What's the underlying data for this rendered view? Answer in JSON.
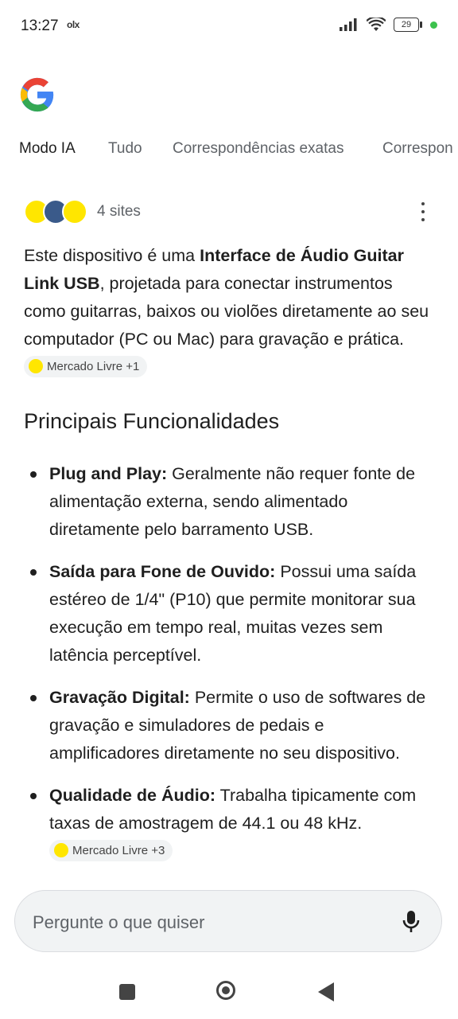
{
  "status_bar": {
    "time": "13:27",
    "notification": "olx",
    "battery": "29"
  },
  "tabs": [
    "Modo IA",
    "Tudo",
    "Correspondências exatas",
    "Correspon"
  ],
  "sources": {
    "count_label": "4 sites"
  },
  "answer": {
    "p_start": "Este dispositivo é uma ",
    "p_bold": "Interface de Áudio Guitar Link USB",
    "p_rest": ", projetada para conectar instrumentos como guitarras, baixos ou violões diretamente ao seu computador (PC ou Mac) para gravação e prática.",
    "p_chip": "Mercado Livre +1"
  },
  "section_title": "Principais Funcionalidades",
  "features": [
    {
      "title": "Plug and Play:",
      "text": " Geralmente não requer fonte de alimentação externa, sendo alimentado diretamente pelo barramento USB."
    },
    {
      "title": "Saída para Fone de Ouvido:",
      "text": " Possui uma saída estéreo de 1/4\" (P10) que permite monitorar sua execução em tempo real, muitas vezes sem latência perceptível."
    },
    {
      "title": "Gravação Digital:",
      "text": " Permite o uso de softwares de gravação e simuladores de pedais e amplificadores diretamente no seu dispositivo."
    },
    {
      "title": "Qualidade de Áudio:",
      "text": " Trabalha tipicamente com taxas de amostragem de 44.1 ou 48 kHz.",
      "chip": "Mercado Livre +3"
    }
  ],
  "input": {
    "placeholder": "Pergunte o que quiser"
  },
  "colors": {
    "text": "#1f1f1f",
    "muted": "#5f6368",
    "chip_bg": "#f1f3f4",
    "ml_yellow": "#ffe600"
  }
}
